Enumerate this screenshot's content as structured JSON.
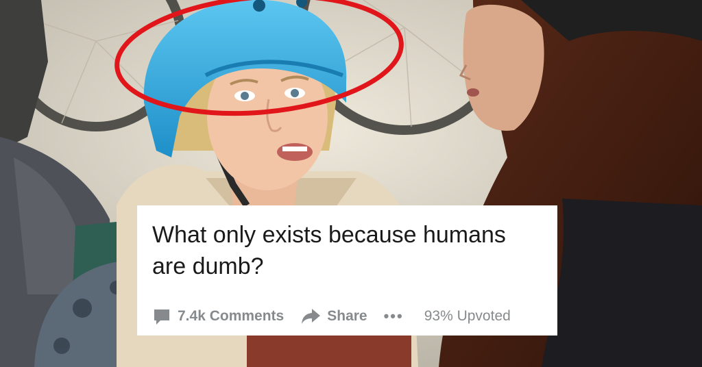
{
  "post": {
    "title": "What only exists because humans are dumb?",
    "comments_label": "7.4k Comments",
    "share_label": "Share",
    "more_label": "•••",
    "upvoted_label": "93% Upvoted"
  },
  "icons": {
    "comments": "comment-bubble-icon",
    "share": "share-arrow-icon",
    "more": "more-dots-icon"
  },
  "colors": {
    "helmet": "#2aa7df",
    "annotation_circle": "#e0161a",
    "card_background": "#ffffff",
    "title_text": "#1a1a1b",
    "meta_text": "#878a8c"
  }
}
